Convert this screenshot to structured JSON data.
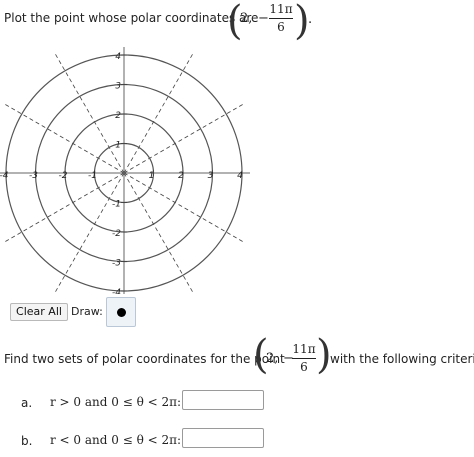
{
  "question1": {
    "prompt": "Plot the point whose polar coordinates are",
    "r": "2,",
    "minus": "−",
    "theta_num": "11π",
    "theta_den": "6",
    "end": "."
  },
  "graph": {
    "x_ticks": [
      "-4",
      "-3",
      "-2",
      "-1",
      "1",
      "2",
      "3",
      "4"
    ],
    "y_ticks": [
      "4",
      "3",
      "2",
      "1",
      "-1",
      "-2",
      "-3",
      "-4"
    ],
    "ring_radii": [
      1,
      2,
      3,
      4
    ]
  },
  "toolbar": {
    "clear_label": "Clear All",
    "draw_label": "Draw:",
    "tool_icon": "point-tool-icon"
  },
  "question2": {
    "prompt": "Find two sets of polar coordinates for the point",
    "r": "2,",
    "minus": "−",
    "theta_num": "11π",
    "theta_den": "6",
    "tail": "with the following criteria."
  },
  "rows": [
    {
      "label": "a.",
      "criteria": "r > 0 and 0 ≤ θ < 2π:",
      "value": ""
    },
    {
      "label": "b.",
      "criteria": "r < 0 and 0 ≤ θ < 2π:",
      "value": ""
    }
  ]
}
